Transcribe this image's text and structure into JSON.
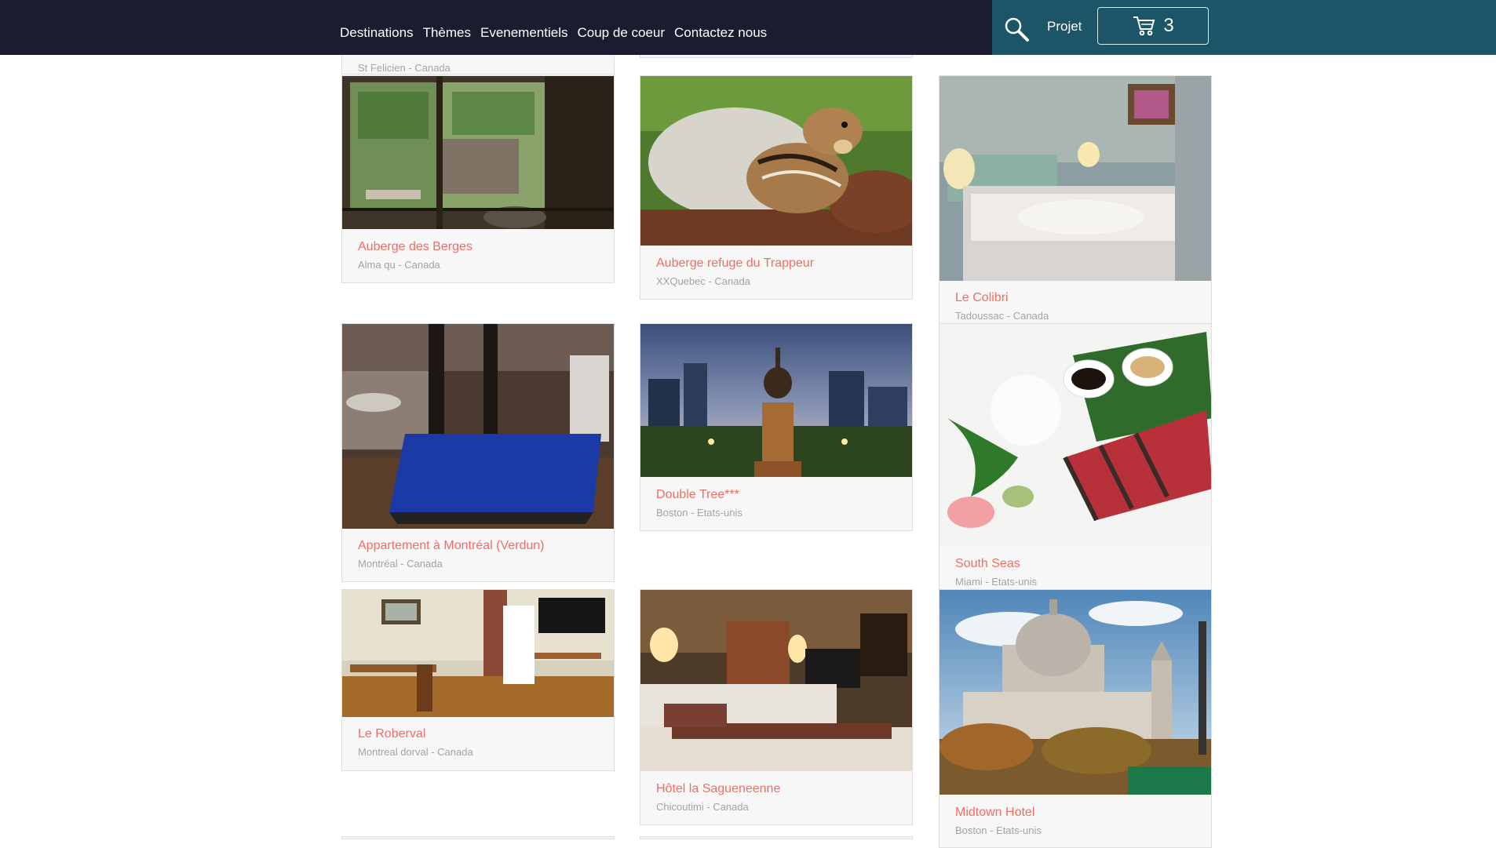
{
  "nav": {
    "items": [
      {
        "label": "Destinations"
      },
      {
        "label": "Thèmes"
      },
      {
        "label": "Evenementiels"
      },
      {
        "label": "Coup de coeur"
      },
      {
        "label": "Contactez nous"
      }
    ]
  },
  "toolbar": {
    "search_icon": "magnifier-icon",
    "projet_label": "Projet",
    "cart_icon": "shopping-cart-icon",
    "cart_count": "3"
  },
  "colors": {
    "header_bg": "#1b1c30",
    "toolbar_bg": "#1c5468",
    "card_title": "#ef6e63",
    "card_subtitle": "#a3a3a3"
  },
  "cards": [
    {
      "title": "",
      "location": "St Felicien - Canada"
    },
    {
      "title": "Auberge des Berges",
      "location": "Alma qu - Canada",
      "image": "window-view-photo"
    },
    {
      "title": "Auberge refuge du Trappeur",
      "location": "XXQuebec - Canada",
      "image": "chipmunk-photo"
    },
    {
      "title": "Le Colibri",
      "location": "Tadoussac - Canada",
      "image": "bedroom-photo"
    },
    {
      "title": "Appartement à Montréal (Verdun)",
      "location": "Montréal - Canada",
      "image": "basement-air-hockey-photo"
    },
    {
      "title": "Double Tree***",
      "location": "Boston - Etats-unis",
      "image": "statue-skyline-photo"
    },
    {
      "title": "South Seas",
      "location": "Miami - Etats-unis",
      "image": "tuna-plate-photo"
    },
    {
      "title": "Le Roberval",
      "location": "Montreal dorval - Canada",
      "image": "hotel-room-desk-photo"
    },
    {
      "title": "Hôtel la Sagueneenne",
      "location": "Chicoutimi - Canada",
      "image": "hotel-bedroom-photo"
    },
    {
      "title": "Midtown Hotel",
      "location": "Boston - Etats-unis",
      "image": "domed-church-photo"
    }
  ]
}
